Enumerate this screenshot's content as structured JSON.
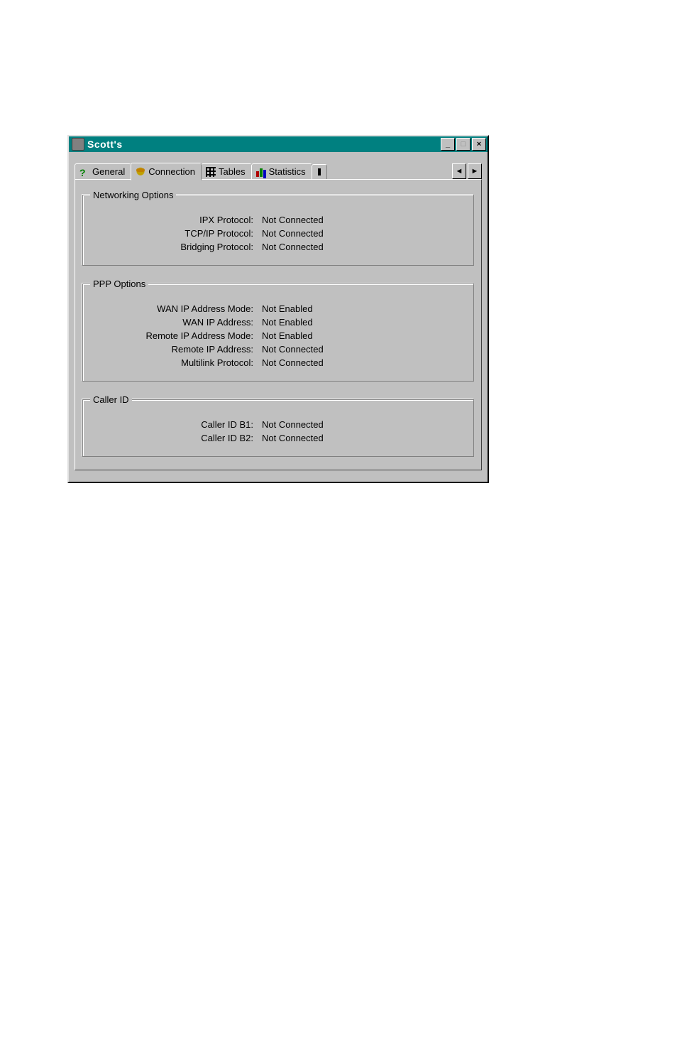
{
  "window": {
    "title": "Scott's",
    "buttons": {
      "minimize": "_",
      "maximize": "□",
      "close": "×"
    }
  },
  "tabs": [
    {
      "icon": "question-icon",
      "label": "General"
    },
    {
      "icon": "phone-icon",
      "label": "Connection",
      "active": true
    },
    {
      "icon": "tables-icon",
      "label": "Tables"
    },
    {
      "icon": "statistics-icon",
      "label": "Statistics"
    }
  ],
  "tab_scroll": {
    "left": "◄",
    "right": "►"
  },
  "groups": {
    "networking": {
      "legend": "Networking Options",
      "rows": [
        {
          "label": "IPX Protocol:",
          "value": "Not Connected"
        },
        {
          "label": "TCP/IP Protocol:",
          "value": "Not Connected"
        },
        {
          "label": "Bridging Protocol:",
          "value": "Not Connected"
        }
      ]
    },
    "ppp": {
      "legend": "PPP Options",
      "rows": [
        {
          "label": "WAN IP Address Mode:",
          "value": "Not Enabled"
        },
        {
          "label": "WAN IP Address:",
          "value": "Not Enabled"
        },
        {
          "label": "Remote IP Address Mode:",
          "value": "Not Enabled"
        },
        {
          "label": "Remote IP Address:",
          "value": "Not Connected"
        },
        {
          "label": "Multilink Protocol:",
          "value": "Not Connected"
        }
      ]
    },
    "callerid": {
      "legend": "Caller ID",
      "rows": [
        {
          "label": "Caller ID B1:",
          "value": "Not Connected"
        },
        {
          "label": "Caller ID B2:",
          "value": "Not Connected"
        }
      ]
    }
  }
}
